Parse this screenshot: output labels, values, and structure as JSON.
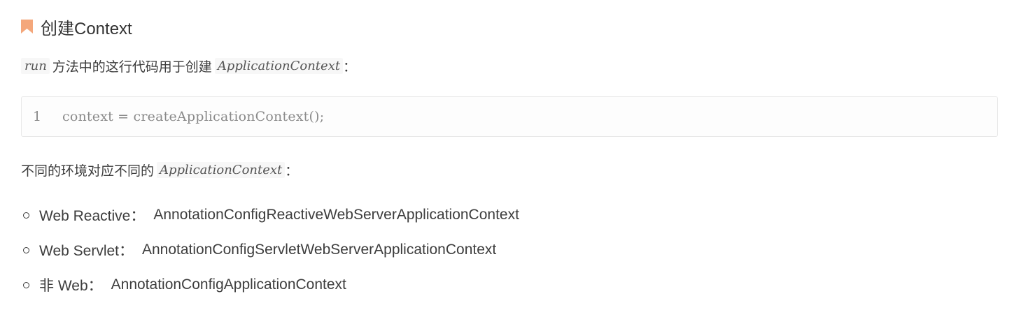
{
  "heading": {
    "icon": "bookmark-icon",
    "icon_color": "#f4a77b",
    "text": "创建Context"
  },
  "paragraph1": {
    "code_before": "run",
    "text": "方法中的这行代码用于创建",
    "code_after": "ApplicationContext",
    "punct": "："
  },
  "code_block": {
    "line_number": "1",
    "code": "context = createApplicationContext();"
  },
  "paragraph2": {
    "text": "不同的环境对应不同的",
    "code": "ApplicationContext",
    "punct": "："
  },
  "list": [
    {
      "label": "Web Reactive：",
      "value": "AnnotationConfigReactiveWebServerApplicationContext"
    },
    {
      "label": "Web Servlet：",
      "value": "AnnotationConfigServletWebServerApplicationContext"
    },
    {
      "label": "非 Web：",
      "value": "AnnotationConfigApplicationContext"
    }
  ]
}
